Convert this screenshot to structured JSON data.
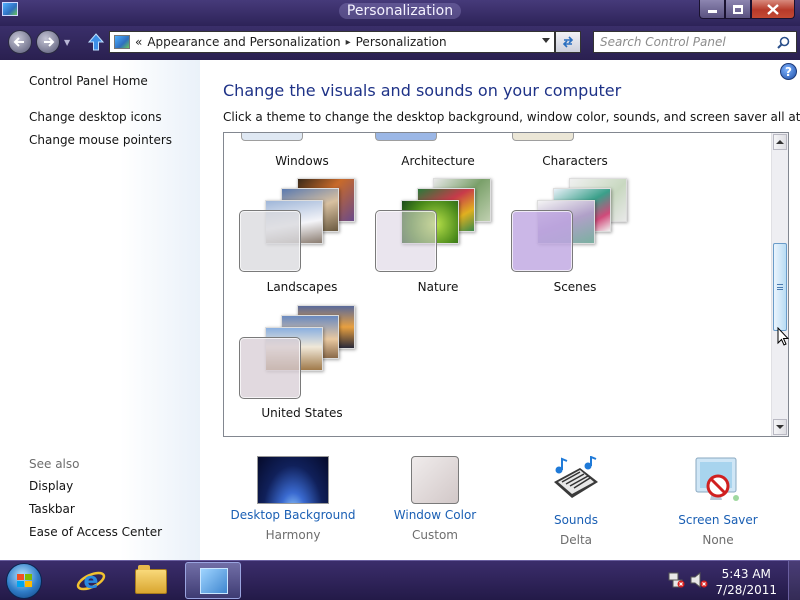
{
  "window": {
    "title": "Personalization"
  },
  "address_bar": {
    "overflow_chevron": "«",
    "crumbs": [
      "Appearance and Personalization",
      "Personalization"
    ],
    "separator": "▸"
  },
  "search": {
    "placeholder": "Search Control Panel"
  },
  "left_pane": {
    "links": [
      "Control Panel Home",
      "Change desktop icons",
      "Change mouse pointers"
    ],
    "see_also_label": "See also",
    "see_also_links": [
      "Display",
      "Taskbar",
      "Ease of Access Center"
    ]
  },
  "main": {
    "heading": "Change the visuals and sounds on your computer",
    "subtitle": "Click a theme to change the desktop background, window color, sounds, and screen saver all at once.",
    "help": "?"
  },
  "themes": {
    "partial_row": [
      "Windows",
      "Architecture",
      "Characters"
    ],
    "items": [
      {
        "name": "Landscapes",
        "swatch_color": "#d8d8dc"
      },
      {
        "name": "Nature",
        "swatch_color": "#d9cfe0"
      },
      {
        "name": "Scenes",
        "swatch_color": "#c8b4e4"
      },
      {
        "name": "United States",
        "swatch_color": "#d7ccd4"
      }
    ]
  },
  "tiles": [
    {
      "label": "Desktop Background",
      "value": "Harmony",
      "icon": "wallpaper-thumbnail"
    },
    {
      "label": "Window Color",
      "value": "Custom",
      "icon": "color-swatch"
    },
    {
      "label": "Sounds",
      "value": "Delta",
      "icon": "music-notes-icon"
    },
    {
      "label": "Screen Saver",
      "value": "None",
      "icon": "screen-saver-icon"
    }
  ],
  "taskbar": {
    "time": "5:43 AM",
    "date": "7/28/2011"
  },
  "colors": {
    "heading": "#1e3287",
    "link": "#1a5fb4",
    "title_bar": "#2d2358"
  }
}
